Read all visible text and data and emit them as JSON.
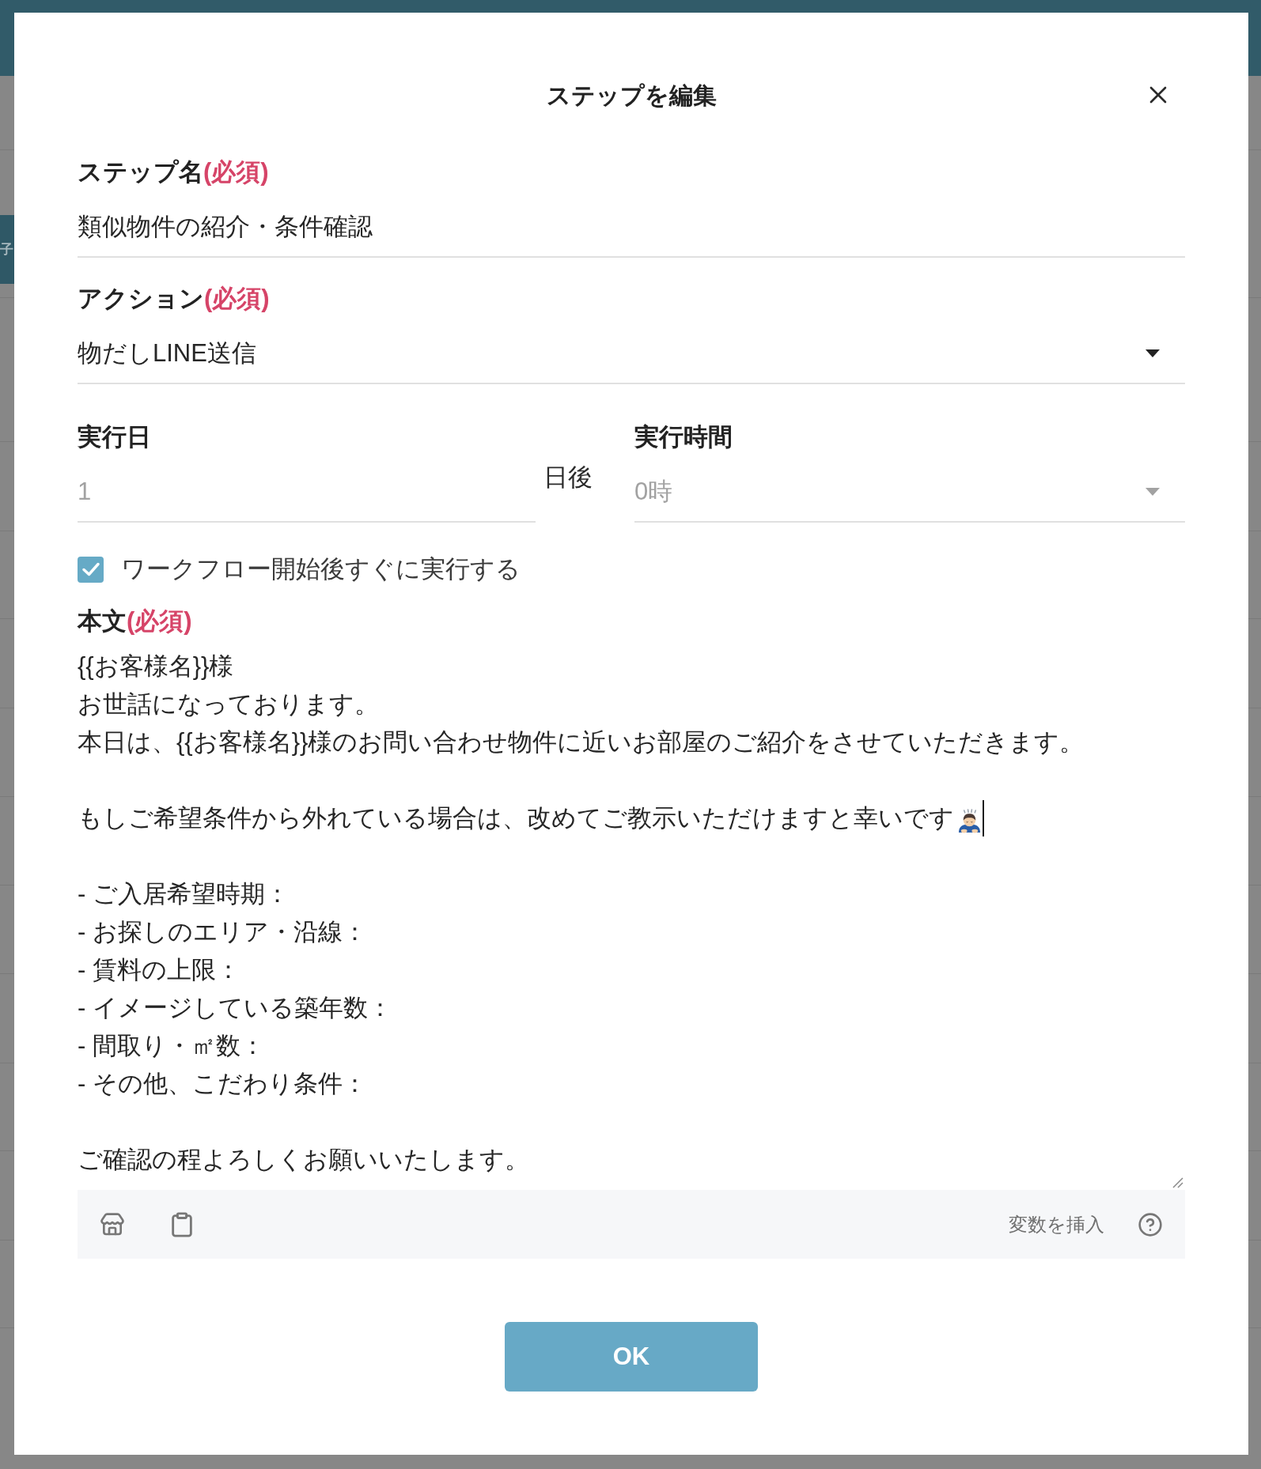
{
  "backdrop": {
    "side_tab": "子"
  },
  "dialog": {
    "title": "ステップを編集",
    "step_name": {
      "label": "ステップ名",
      "required_mark": "(必須)",
      "value": "類似物件の紹介・条件確認"
    },
    "action": {
      "label": "アクション",
      "required_mark": "(必須)",
      "value": "物だしLINE送信"
    },
    "run_day": {
      "label": "実行日",
      "value": "1",
      "unit": "日後",
      "disabled": true
    },
    "run_time": {
      "label": "実行時間",
      "value": "0時",
      "disabled": true
    },
    "run_immediately": {
      "label": "ワークフロー開始後すぐに実行する",
      "checked": true
    },
    "body": {
      "label": "本文",
      "required_mark": "(必須)",
      "paragraphs": [
        {
          "lines": [
            "{{お客様名}}様",
            "お世話になっております。",
            "本日は、{{お客様名}}様のお問い合わせ物件に近いお部屋のご紹介をさせていただきます。"
          ],
          "emoji": false,
          "cursor": false
        },
        {
          "lines": [
            "もしご希望条件から外れている場合は、改めてご教示いただけますと幸いです"
          ],
          "emoji": true,
          "cursor": true
        },
        {
          "lines": [
            "- ご入居希望時期：",
            "- お探しのエリア・沿線：",
            "- 賃料の上限：",
            "- イメージしている築年数：",
            "- 間取り・㎡数：",
            "- その他、こだわり条件："
          ],
          "emoji": false,
          "cursor": false
        },
        {
          "lines": [
            "ご確認の程よろしくお願いいたします。"
          ],
          "emoji": false,
          "cursor": false
        }
      ]
    },
    "toolbar": {
      "insert_variable": "変数を挿入"
    },
    "ok_button": "OK"
  }
}
